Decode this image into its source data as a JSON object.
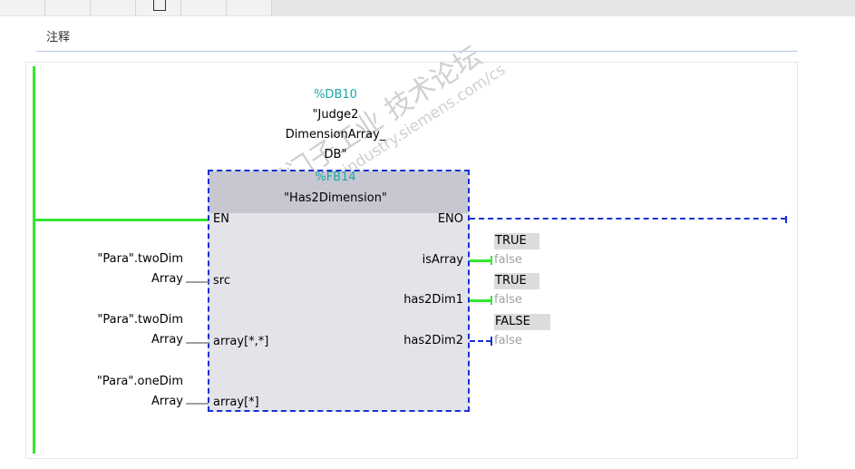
{
  "comment": {
    "label": "注释"
  },
  "watermark": {
    "line1": "西门子工业 技术论坛",
    "line2": "support.industry.siemens.com/cs"
  },
  "block": {
    "db": "%DB10",
    "instance_db_lines": [
      "\"Judge2",
      "DimensionArray_",
      "DB\""
    ],
    "fb": "%FB14",
    "name": "\"Has2Dimension\"",
    "en": "EN",
    "eno": "ENO",
    "inputs": [
      {
        "pin": "src",
        "operand_line1": "\"Para\".twoDim",
        "operand_line2": "Array"
      },
      {
        "pin": "array[*,*]",
        "operand_line1": "\"Para\".twoDim",
        "operand_line2": "Array"
      },
      {
        "pin": "array[*]",
        "operand_line1": "\"Para\".oneDim",
        "operand_line2": "Array"
      }
    ],
    "outputs": [
      {
        "pin": "isArray",
        "monitor": "TRUE",
        "operand": "false"
      },
      {
        "pin": "has2Dim1",
        "monitor": "TRUE",
        "operand": "false"
      },
      {
        "pin": "has2Dim2",
        "monitor": "FALSE",
        "operand": "false"
      }
    ]
  },
  "colors": {
    "power_flow": "#33e633",
    "no_power_flow": "#1a2fd6",
    "address": "#1aa8a8"
  }
}
